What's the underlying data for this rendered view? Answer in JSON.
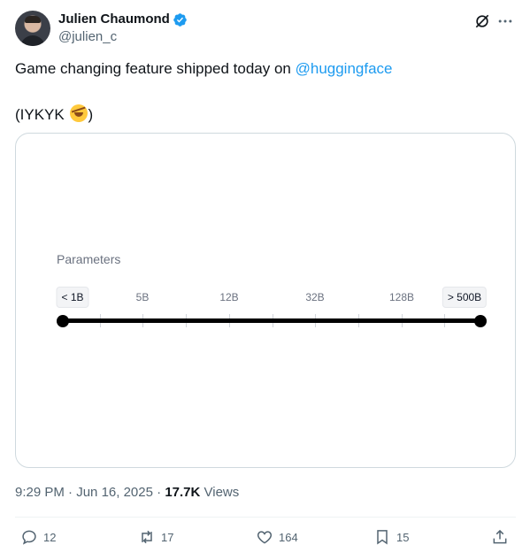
{
  "author": {
    "display_name": "Julien Chaumond",
    "handle": "@julien_c",
    "verified": true,
    "avatar_icon": "avatar"
  },
  "tweet": {
    "text_prefix": "Game changing feature shipped today on ",
    "mention": "@huggingface",
    "line2": "(IYKYK ",
    "line2_end": ")",
    "emoji": "rolling-on-floor-laughing"
  },
  "card": {
    "label": "Parameters",
    "ticks": [
      "< 1B",
      "5B",
      "12B",
      "32B",
      "128B",
      "> 500B"
    ],
    "slider_min": "< 1B",
    "slider_max": "> 500B"
  },
  "meta": {
    "time": "9:29 PM",
    "sep1": " · ",
    "date": "Jun 16, 2025",
    "sep2": " · ",
    "views_count": "17.7K",
    "views_label": " Views"
  },
  "actions": {
    "replies": "12",
    "reposts": "17",
    "likes": "164",
    "bookmarks": "15"
  },
  "colors": {
    "accent": "#1d9bf0",
    "muted": "#536471",
    "border": "#cfd9de"
  }
}
